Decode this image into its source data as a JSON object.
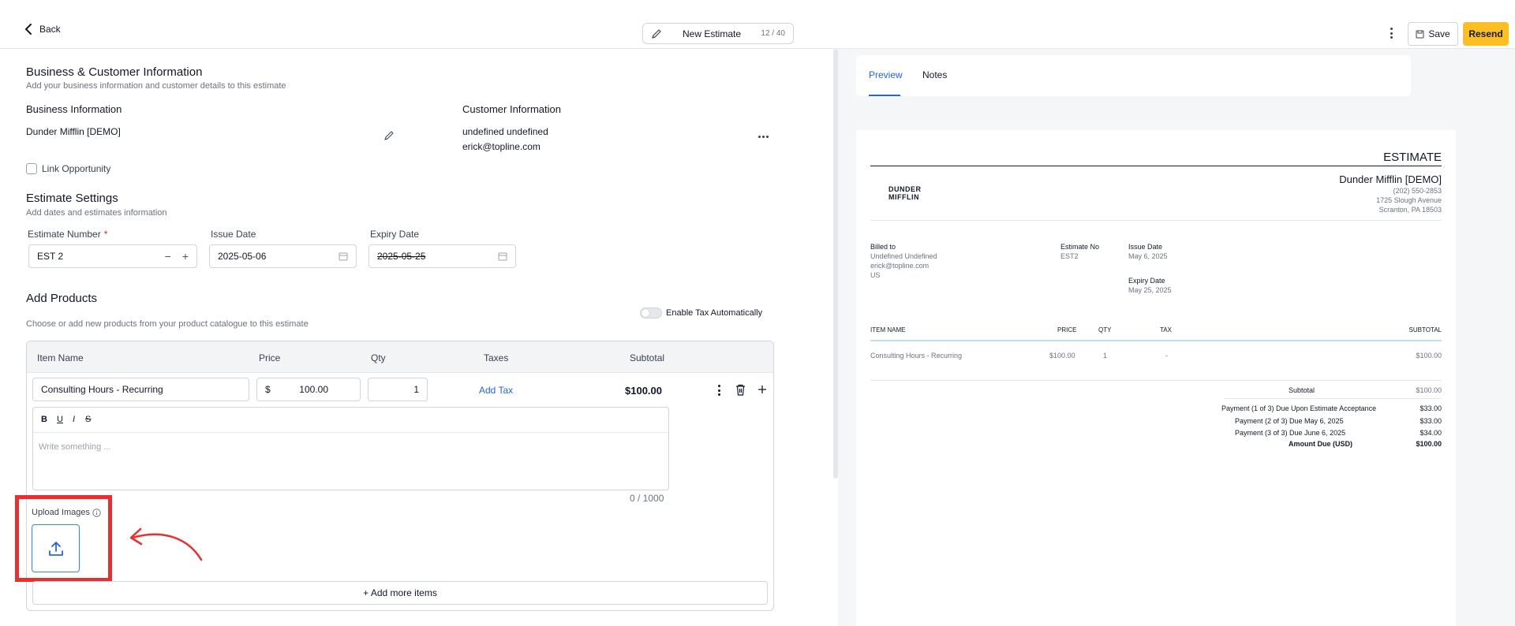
{
  "header": {
    "back_label": "Back",
    "doc_title": "New Estimate",
    "title_count": "12 / 40",
    "save_label": "Save",
    "resend_label": "Resend"
  },
  "business_customer": {
    "title": "Business & Customer Information",
    "subtitle": "Add your business information and customer details to this estimate",
    "business_heading": "Business Information",
    "business_name": "Dunder Mifflin [DEMO]",
    "customer_heading": "Customer Information",
    "customer_name": "undefined undefined",
    "customer_email": "erick@topline.com",
    "link_opportunity": "Link Opportunity"
  },
  "estimate_settings": {
    "title": "Estimate Settings",
    "subtitle": "Add dates and estimates information",
    "number_label": "Estimate Number",
    "required_mark": "*",
    "number_value": "EST 2",
    "issue_label": "Issue Date",
    "issue_value": "2025-05-06",
    "expiry_label": "Expiry Date",
    "expiry_value": "2025-05-25"
  },
  "products": {
    "title": "Add Products",
    "subtitle": "Choose or add new products from your product catalogue to this estimate",
    "tax_toggle_label": "Enable Tax Automatically",
    "columns": {
      "item": "Item Name",
      "price": "Price",
      "qty": "Qty",
      "taxes": "Taxes",
      "subtotal": "Subtotal"
    },
    "row": {
      "item_name": "Consulting Hours - Recurring",
      "currency": "$",
      "price": "100.00",
      "qty": "1",
      "add_tax": "Add Tax",
      "subtotal": "$100.00"
    },
    "editor_placeholder": "Write something ...",
    "char_count": "0 / 1000",
    "upload_label": "Upload Images",
    "add_more": "+ Add more items"
  },
  "tabs": {
    "preview": "Preview",
    "notes": "Notes"
  },
  "preview": {
    "heading": "ESTIMATE",
    "logo_line1": "DUNDER",
    "logo_line2": "MIFFLIN",
    "company": "Dunder Mifflin [DEMO]",
    "phone": "(202) 550-2853",
    "address1": "1725 Slough Avenue",
    "address2": "Scranton, PA 18503",
    "billed_to_label": "Billed to",
    "billed_name": "Undefined Undefined",
    "billed_email": "erick@topline.com",
    "billed_country": "US",
    "estimate_no_label": "Estimate No",
    "estimate_no": "EST2",
    "issue_label": "Issue Date",
    "issue_date": "May 6, 2025",
    "expiry_label": "Expiry Date",
    "expiry_date": "May 25, 2025",
    "cols": {
      "item": "ITEM NAME",
      "price": "PRICE",
      "qty": "QTY",
      "tax": "TAX",
      "subtotal": "SUBTOTAL"
    },
    "line": {
      "item": "Consulting Hours - Recurring",
      "price": "$100.00",
      "qty": "1",
      "tax": "-",
      "subtotal": "$100.00"
    },
    "subtotal_label": "Subtotal",
    "subtotal_value": "$100.00",
    "payments": [
      {
        "label": "Payment (1 of 3) Due Upon Estimate Acceptance",
        "value": "$33.00"
      },
      {
        "label": "Payment (2 of 3) Due May 6, 2025",
        "value": "$33.00"
      },
      {
        "label": "Payment (3 of 3) Due June 6, 2025",
        "value": "$34.00"
      }
    ],
    "amount_due_label": "Amount Due (USD)",
    "amount_due_value": "$100.00"
  },
  "colors": {
    "accent": "#2563eb",
    "resend": "#fbbf24",
    "annotation": "#ef2b2b"
  }
}
